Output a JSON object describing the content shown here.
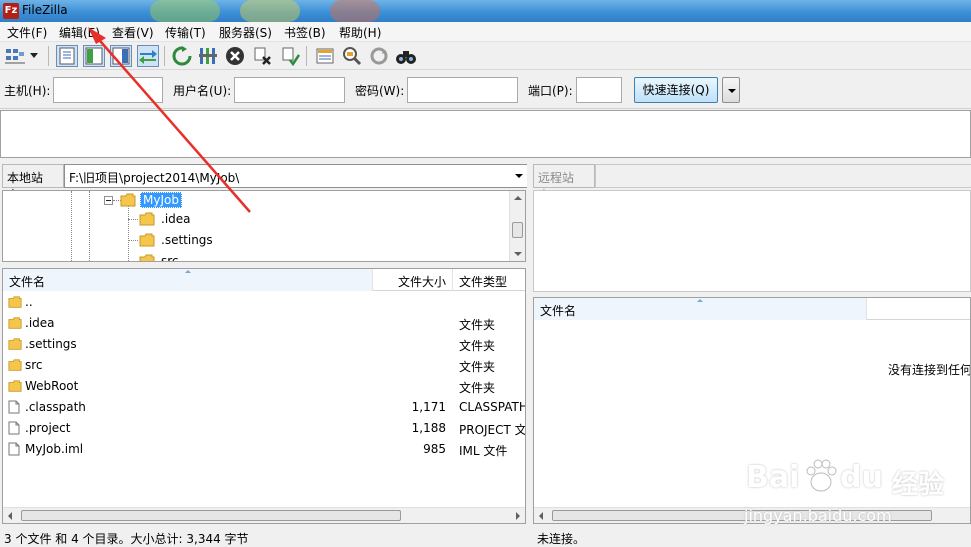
{
  "window": {
    "title": "FileZilla",
    "app_icon": "Fz"
  },
  "menu": [
    "文件(F)",
    "编辑(E)",
    "查看(V)",
    "传输(T)",
    "服务器(S)",
    "书签(B)",
    "帮助(H)"
  ],
  "toolbar": {
    "icons": [
      "site-manager-icon",
      "dropdown-arrow-icon",
      "toggle-message-log-icon",
      "toggle-local-tree-icon",
      "toggle-remote-tree-icon",
      "toggle-transfer-queue-icon",
      "refresh-icon",
      "process-queue-icon",
      "cancel-icon",
      "disconnect-icon",
      "reconnect-icon",
      "directory-listing-filters-icon",
      "compare-directories-icon",
      "sync-browsing-icon",
      "search-files-icon"
    ]
  },
  "quickconnect": {
    "host_label": "主机(H):",
    "user_label": "用户名(U):",
    "pass_label": "密码(W):",
    "port_label": "端口(P):",
    "button_label": "快速连接(Q)",
    "host_value": "",
    "user_value": "",
    "pass_value": "",
    "port_value": ""
  },
  "local": {
    "site_label": "本地站点:",
    "path": "F:\\旧项目\\project2014\\MyJob\\",
    "tree": [
      {
        "name": "MyJob",
        "selected": true
      },
      {
        "name": ".idea"
      },
      {
        "name": ".settings"
      },
      {
        "name": "src"
      }
    ],
    "columns": {
      "name": "文件名",
      "size": "文件大小",
      "type": "文件类型"
    },
    "files": [
      {
        "name": "..",
        "size": "",
        "type": "",
        "icon": "folder-icon"
      },
      {
        "name": ".idea",
        "size": "",
        "type": "文件夹",
        "icon": "folder-icon"
      },
      {
        "name": ".settings",
        "size": "",
        "type": "文件夹",
        "icon": "folder-icon"
      },
      {
        "name": "src",
        "size": "",
        "type": "文件夹",
        "icon": "folder-icon"
      },
      {
        "name": "WebRoot",
        "size": "",
        "type": "文件夹",
        "icon": "folder-icon"
      },
      {
        "name": ".classpath",
        "size": "1,171",
        "type": "CLASSPATH",
        "icon": "file-icon"
      },
      {
        "name": ".project",
        "size": "1,188",
        "type": "PROJECT 文",
        "icon": "file-icon"
      },
      {
        "name": "MyJob.iml",
        "size": "985",
        "type": "IML 文件",
        "icon": "file-icon"
      }
    ],
    "status": "3 个文件 和 4 个目录。大小总计: 3,344 字节"
  },
  "remote": {
    "site_label": "远程站点:",
    "path": "",
    "columns": {
      "name": "文件名"
    },
    "empty_message": "没有连接到任何",
    "status": "未连接。"
  },
  "watermark": {
    "brand": "Bai",
    "brand2": "经验",
    "url": "jingyan.baidu.com"
  },
  "colors": {
    "selection": "#3399ff",
    "folder": "#f5c54c",
    "annotation_arrow": "#e8302a"
  }
}
